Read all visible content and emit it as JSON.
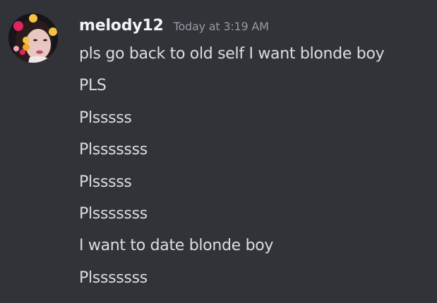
{
  "message": {
    "author": {
      "username": "melody12",
      "avatar_icon": "user-avatar"
    },
    "timestamp": "Today at 3:19 AM",
    "lines": [
      "pls go back to old self I want blonde boy",
      "PLS",
      "Plsssss",
      "Plsssssss",
      "Plsssss",
      "Plsssssss",
      "I want to date blonde boy",
      "Plsssssss"
    ]
  },
  "colors": {
    "background": "#313338",
    "username": "#f2f3f5",
    "timestamp": "#949ba4",
    "text": "#dbdee1"
  }
}
